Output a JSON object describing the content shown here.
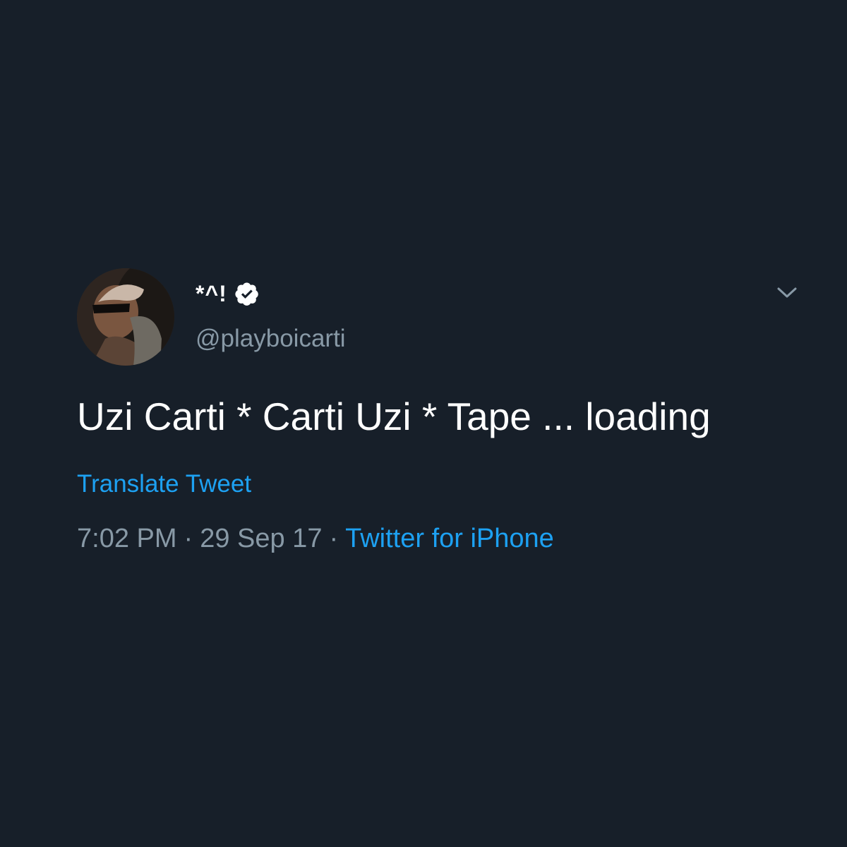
{
  "tweet": {
    "display_name": "*^!",
    "verified": true,
    "handle": "@playboicarti",
    "text": "Uzi Carti * Carti Uzi * Tape ... loading",
    "translate_label": "Translate Tweet",
    "time": "7:02 PM",
    "date": "29 Sep 17",
    "separator": "·",
    "source": "Twitter for iPhone"
  },
  "icons": {
    "verified": "verified-badge-icon",
    "menu": "chevron-down-icon"
  },
  "colors": {
    "background": "#171f29",
    "text": "#ffffff",
    "secondary": "#8899a6",
    "link": "#1da1f2"
  }
}
